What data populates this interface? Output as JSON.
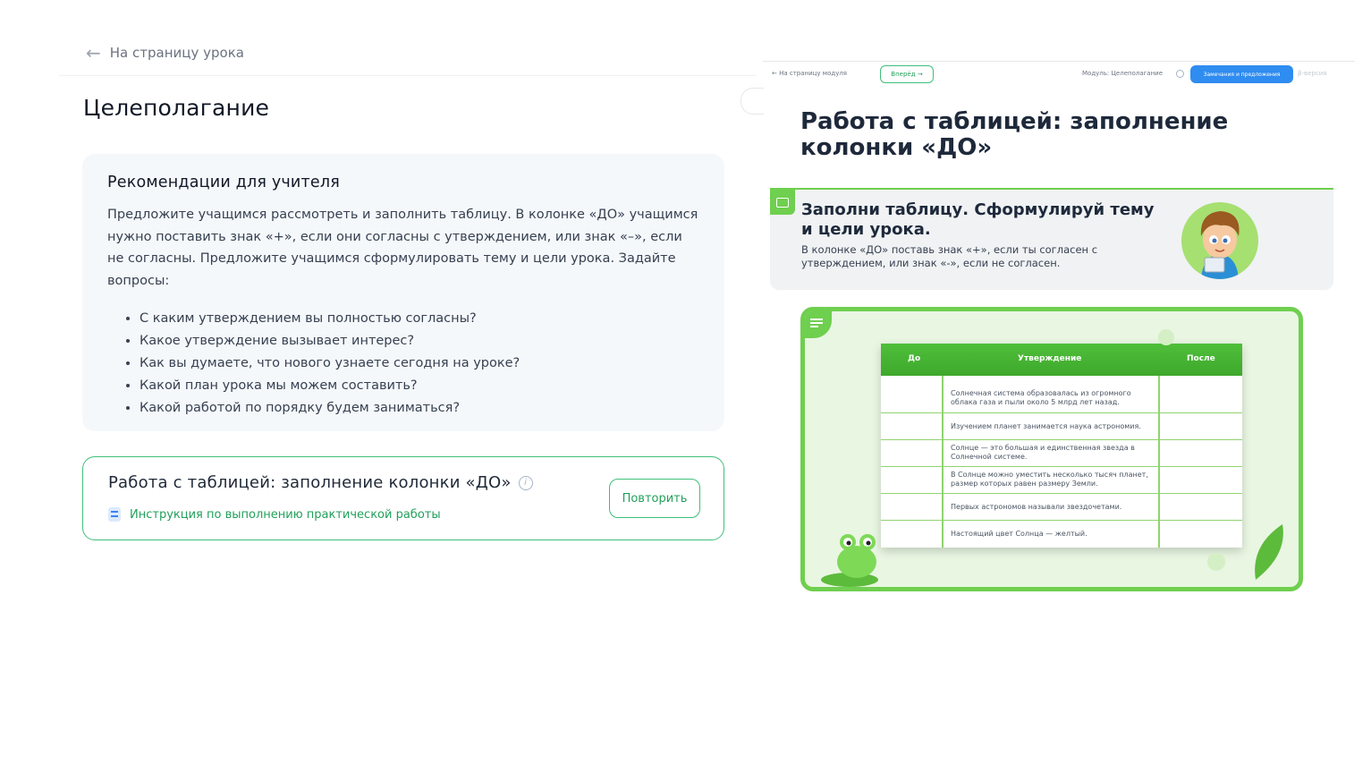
{
  "left": {
    "back_label": "На страницу урока",
    "title": "Целеполагание",
    "recommendations": {
      "title": "Рекомендации для учителя",
      "text": "Предложите учащимся рассмотреть и заполнить таблицу. В колонке «ДО» учащимся нужно поставить знак «+», если они согласны с утверждением, или знак «–», если не согласны. Предложите учащимся сформулировать тему и цели урока. Задайте вопросы:",
      "questions": [
        "С каким утверждением вы полностью согласны?",
        "Какое утверждение вызывает интерес?",
        "Как вы думаете, что нового узнаете сегодня на уроке?",
        "Какой план урока мы можем составить?",
        "Какой работой по порядку будем заниматься?"
      ]
    },
    "task": {
      "title": "Работа с таблицей: заполнение колонки «ДО»",
      "instruction_link": "Инструкция по выполнению практической работы",
      "repeat_label": "Повторить"
    }
  },
  "right": {
    "topbar": {
      "back_label": "На страницу модуля",
      "forward_label": "Вперёд",
      "module_label": "Модуль: Целеполагание",
      "notes_label": "Замечания и предложения",
      "beta_label": "β-версия"
    },
    "title": "Работа с таблицей: заполнение колонки «ДО»",
    "task_head": "Заполни таблицу. Сформулируй тему и цели урока.",
    "task_sub": "В колонке «ДО» поставь знак «+», если ты согласен с утверждением, или знак «-», если не согласен.",
    "table": {
      "headers": [
        "До",
        "Утверждение",
        "После"
      ],
      "rows": [
        "Солнечная система образовалась из огромного облака газа и пыли около 5 млрд лет назад.",
        "Изучением планет занимается наука астрономия.",
        "Солнце — это большая и единственная звезда в Солнечной системе.",
        "В Солнце можно уместить несколько тысяч планет, размер которых равен размеру Земли.",
        "Первых астрономов называли звездочетами.",
        "Настоящий цвет Солнца — желтый."
      ]
    }
  },
  "colors": {
    "accent_green": "#3fbf7a",
    "link_green": "#22a05b",
    "game_green": "#6fcf4f",
    "notes_blue": "#2f8cf0"
  },
  "icons": [
    "arrow-left-icon",
    "info-icon",
    "document-icon",
    "image-icon",
    "menu-icon"
  ]
}
